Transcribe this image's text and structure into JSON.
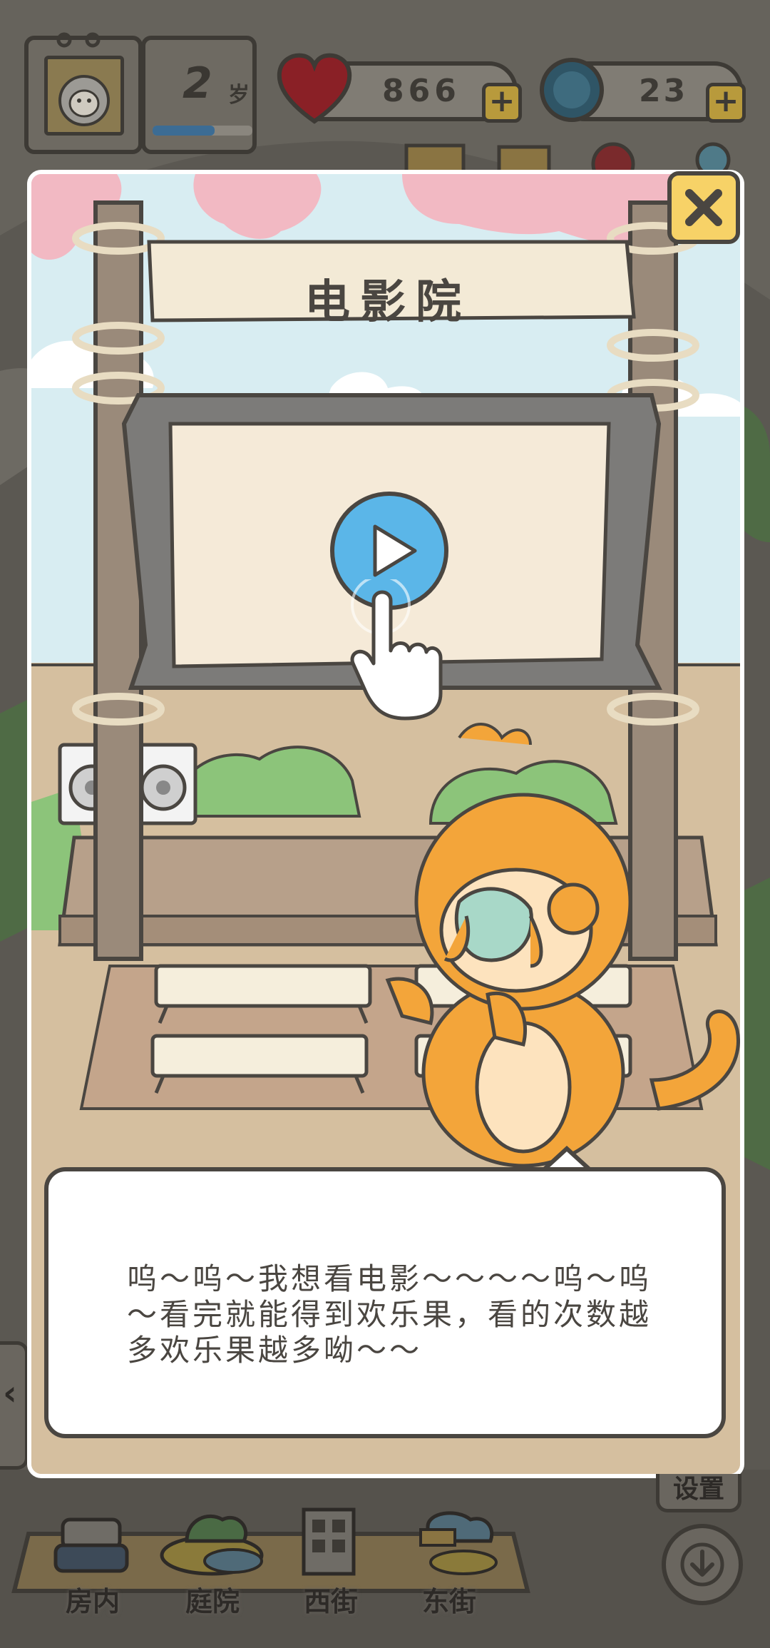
{
  "hud": {
    "age_value": "2",
    "age_unit": "岁",
    "hearts_value": "866",
    "coins_value": "23",
    "colors": {
      "heart": "#c0272d",
      "coin": "#3f6f86",
      "accent_yellow": "#f7d267"
    }
  },
  "modal": {
    "title": "电影院",
    "play_icon": "play-icon",
    "pointer_icon": "hand-pointer-icon",
    "close_icon": "close-icon",
    "dialog_text": "呜～呜～我想看电影～～～～呜～呜～看完就能得到欢乐果，看的次数越多欢乐果越多呦～～"
  },
  "side": {
    "settings_label": "设置",
    "back_icon": "chevron-left-icon",
    "download_icon": "download-icon"
  },
  "bottom_nav": {
    "items": [
      {
        "label": "房内",
        "icon": "room-icon"
      },
      {
        "label": "庭院",
        "icon": "yard-icon"
      },
      {
        "label": "西街",
        "icon": "west-street-icon"
      },
      {
        "label": "东街",
        "icon": "east-street-icon"
      }
    ]
  }
}
